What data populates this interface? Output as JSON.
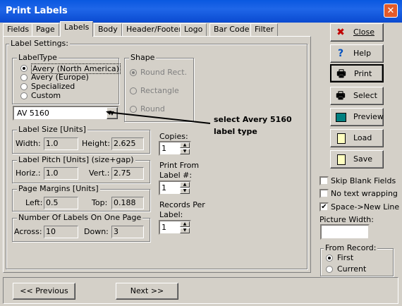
{
  "window": {
    "title": "Print Labels",
    "close_glyph": "✕"
  },
  "tabs": [
    {
      "label": "Fields"
    },
    {
      "label": "Page"
    },
    {
      "label": "Labels"
    },
    {
      "label": "Body"
    },
    {
      "label": "Header/Footer"
    },
    {
      "label": "Logo"
    },
    {
      "label": "Bar Code"
    },
    {
      "label": "Filter"
    }
  ],
  "active_tab": "Labels",
  "label_settings": {
    "title": "Label Settings:",
    "label_type": {
      "title": "LabelType",
      "options": [
        "Avery (North America)",
        "Avery (Europe)",
        "Specialized",
        "Custom"
      ],
      "selected": "Avery (North America)"
    },
    "shape": {
      "title": "Shape",
      "options": [
        "Round Rect.",
        "Rectangle",
        "Round"
      ],
      "selected": "Round Rect."
    },
    "label_select": {
      "value": "AV 5160"
    },
    "label_size": {
      "title": "Label Size [Units]",
      "width_label": "Width:",
      "width": "1.0",
      "height_label": "Height:",
      "height": "2.625"
    },
    "label_pitch": {
      "title": "Label Pitch [Units] (size+gap)",
      "horiz_label": "Horiz.:",
      "horiz": "1.0",
      "vert_label": "Vert.:",
      "vert": "2.75"
    },
    "page_margins": {
      "title": "Page Margins [Units]",
      "left_label": "Left:",
      "left": "0.5",
      "top_label": "Top:",
      "top": "0.188"
    },
    "labels_per_page": {
      "title": "Number Of Labels On One Page",
      "across_label": "Across:",
      "across": "10",
      "down_label": "Down:",
      "down": "3"
    },
    "copies": {
      "label": "Copies:",
      "value": "1"
    },
    "print_from": {
      "label_line1": "Print From",
      "label_line2": "Label #:",
      "value": "1"
    },
    "records_per": {
      "label_line1": "Records Per",
      "label_line2": "Label:",
      "value": "1"
    }
  },
  "annotation": {
    "line1": "select  Avery 5160",
    "line2": "label type"
  },
  "side_buttons": [
    {
      "label": "Close",
      "icon": "close-icon",
      "color": "#c00000"
    },
    {
      "label": "Help",
      "icon": "help-icon",
      "color": "#0050c0"
    },
    {
      "label": "Print",
      "icon": "printer-icon"
    },
    {
      "label": "Select",
      "icon": "select-printer-icon"
    },
    {
      "label": "Preview",
      "icon": "preview-monitor-icon"
    },
    {
      "label": "Load",
      "icon": "load-document-icon"
    },
    {
      "label": "Save",
      "icon": "save-document-icon"
    }
  ],
  "options": {
    "skip_blank": {
      "label": "Skip Blank Fields",
      "checked": false
    },
    "no_wrap": {
      "label": "No text wrapping",
      "checked": false
    },
    "space_newline": {
      "label": "Space->New Line",
      "checked": true
    }
  },
  "picture_width": {
    "label": "Picture Width:",
    "value": ""
  },
  "from_record": {
    "title": "From Record:",
    "options": [
      "First",
      "Current"
    ],
    "selected": "First"
  },
  "nav": {
    "previous": "<< Previous",
    "next": "Next >>"
  }
}
